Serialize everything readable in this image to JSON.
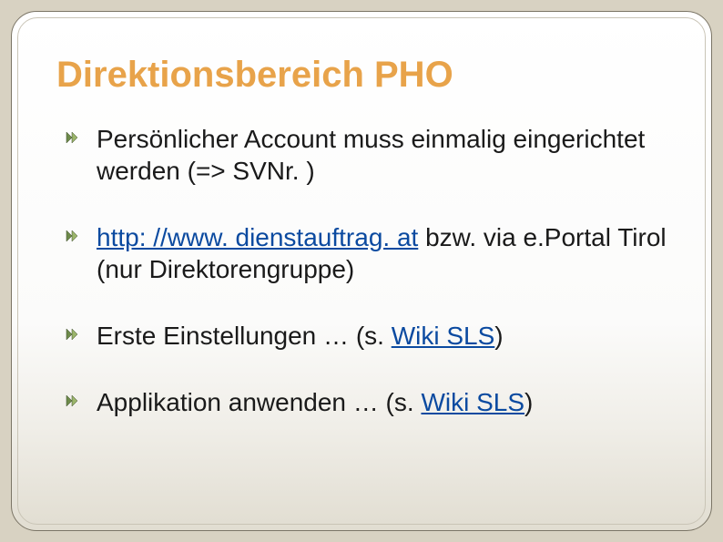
{
  "title": "Direktionsbereich PHO",
  "items": [
    {
      "text_before": "Persönlicher Account muss einmalig eingerichtet werden (=> SVNr. )",
      "link": "",
      "text_after": ""
    },
    {
      "text_before": "",
      "link": "http: //www. dienstauftrag. at",
      "text_after": "  bzw. via e.Portal Tirol (nur Direktorengruppe)"
    },
    {
      "text_before": "Erste Einstellungen … (s. ",
      "link": "Wiki SLS",
      "text_after": ")"
    },
    {
      "text_before": "Applikation anwenden … (s. ",
      "link": "Wiki SLS",
      "text_after": ")"
    }
  ]
}
